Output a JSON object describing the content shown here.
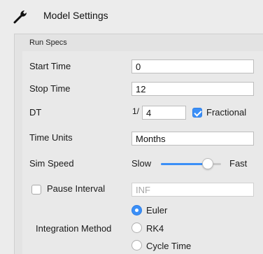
{
  "header": {
    "title": "Model Settings",
    "icon": "wrench-icon"
  },
  "run_specs": {
    "title": "Run Specs",
    "start_time": {
      "label": "Start Time",
      "value": "0"
    },
    "stop_time": {
      "label": "Stop Time",
      "value": "12"
    },
    "dt": {
      "label": "DT",
      "prefix": "1/",
      "value": "4",
      "fractional_label": "Fractional",
      "fractional_checked": true
    },
    "time_units": {
      "label": "Time Units",
      "value": "Months"
    },
    "sim_speed": {
      "label": "Sim Speed",
      "slow_label": "Slow",
      "fast_label": "Fast",
      "level": 0.78
    },
    "pause_interval": {
      "label": "Pause Interval",
      "checked": false,
      "value": "INF"
    },
    "integration": {
      "label": "Integration Method",
      "options": [
        "Euler",
        "RK4",
        "Cycle Time"
      ],
      "selected": "Euler"
    }
  },
  "colors": {
    "accent": "#3b8ff7"
  }
}
